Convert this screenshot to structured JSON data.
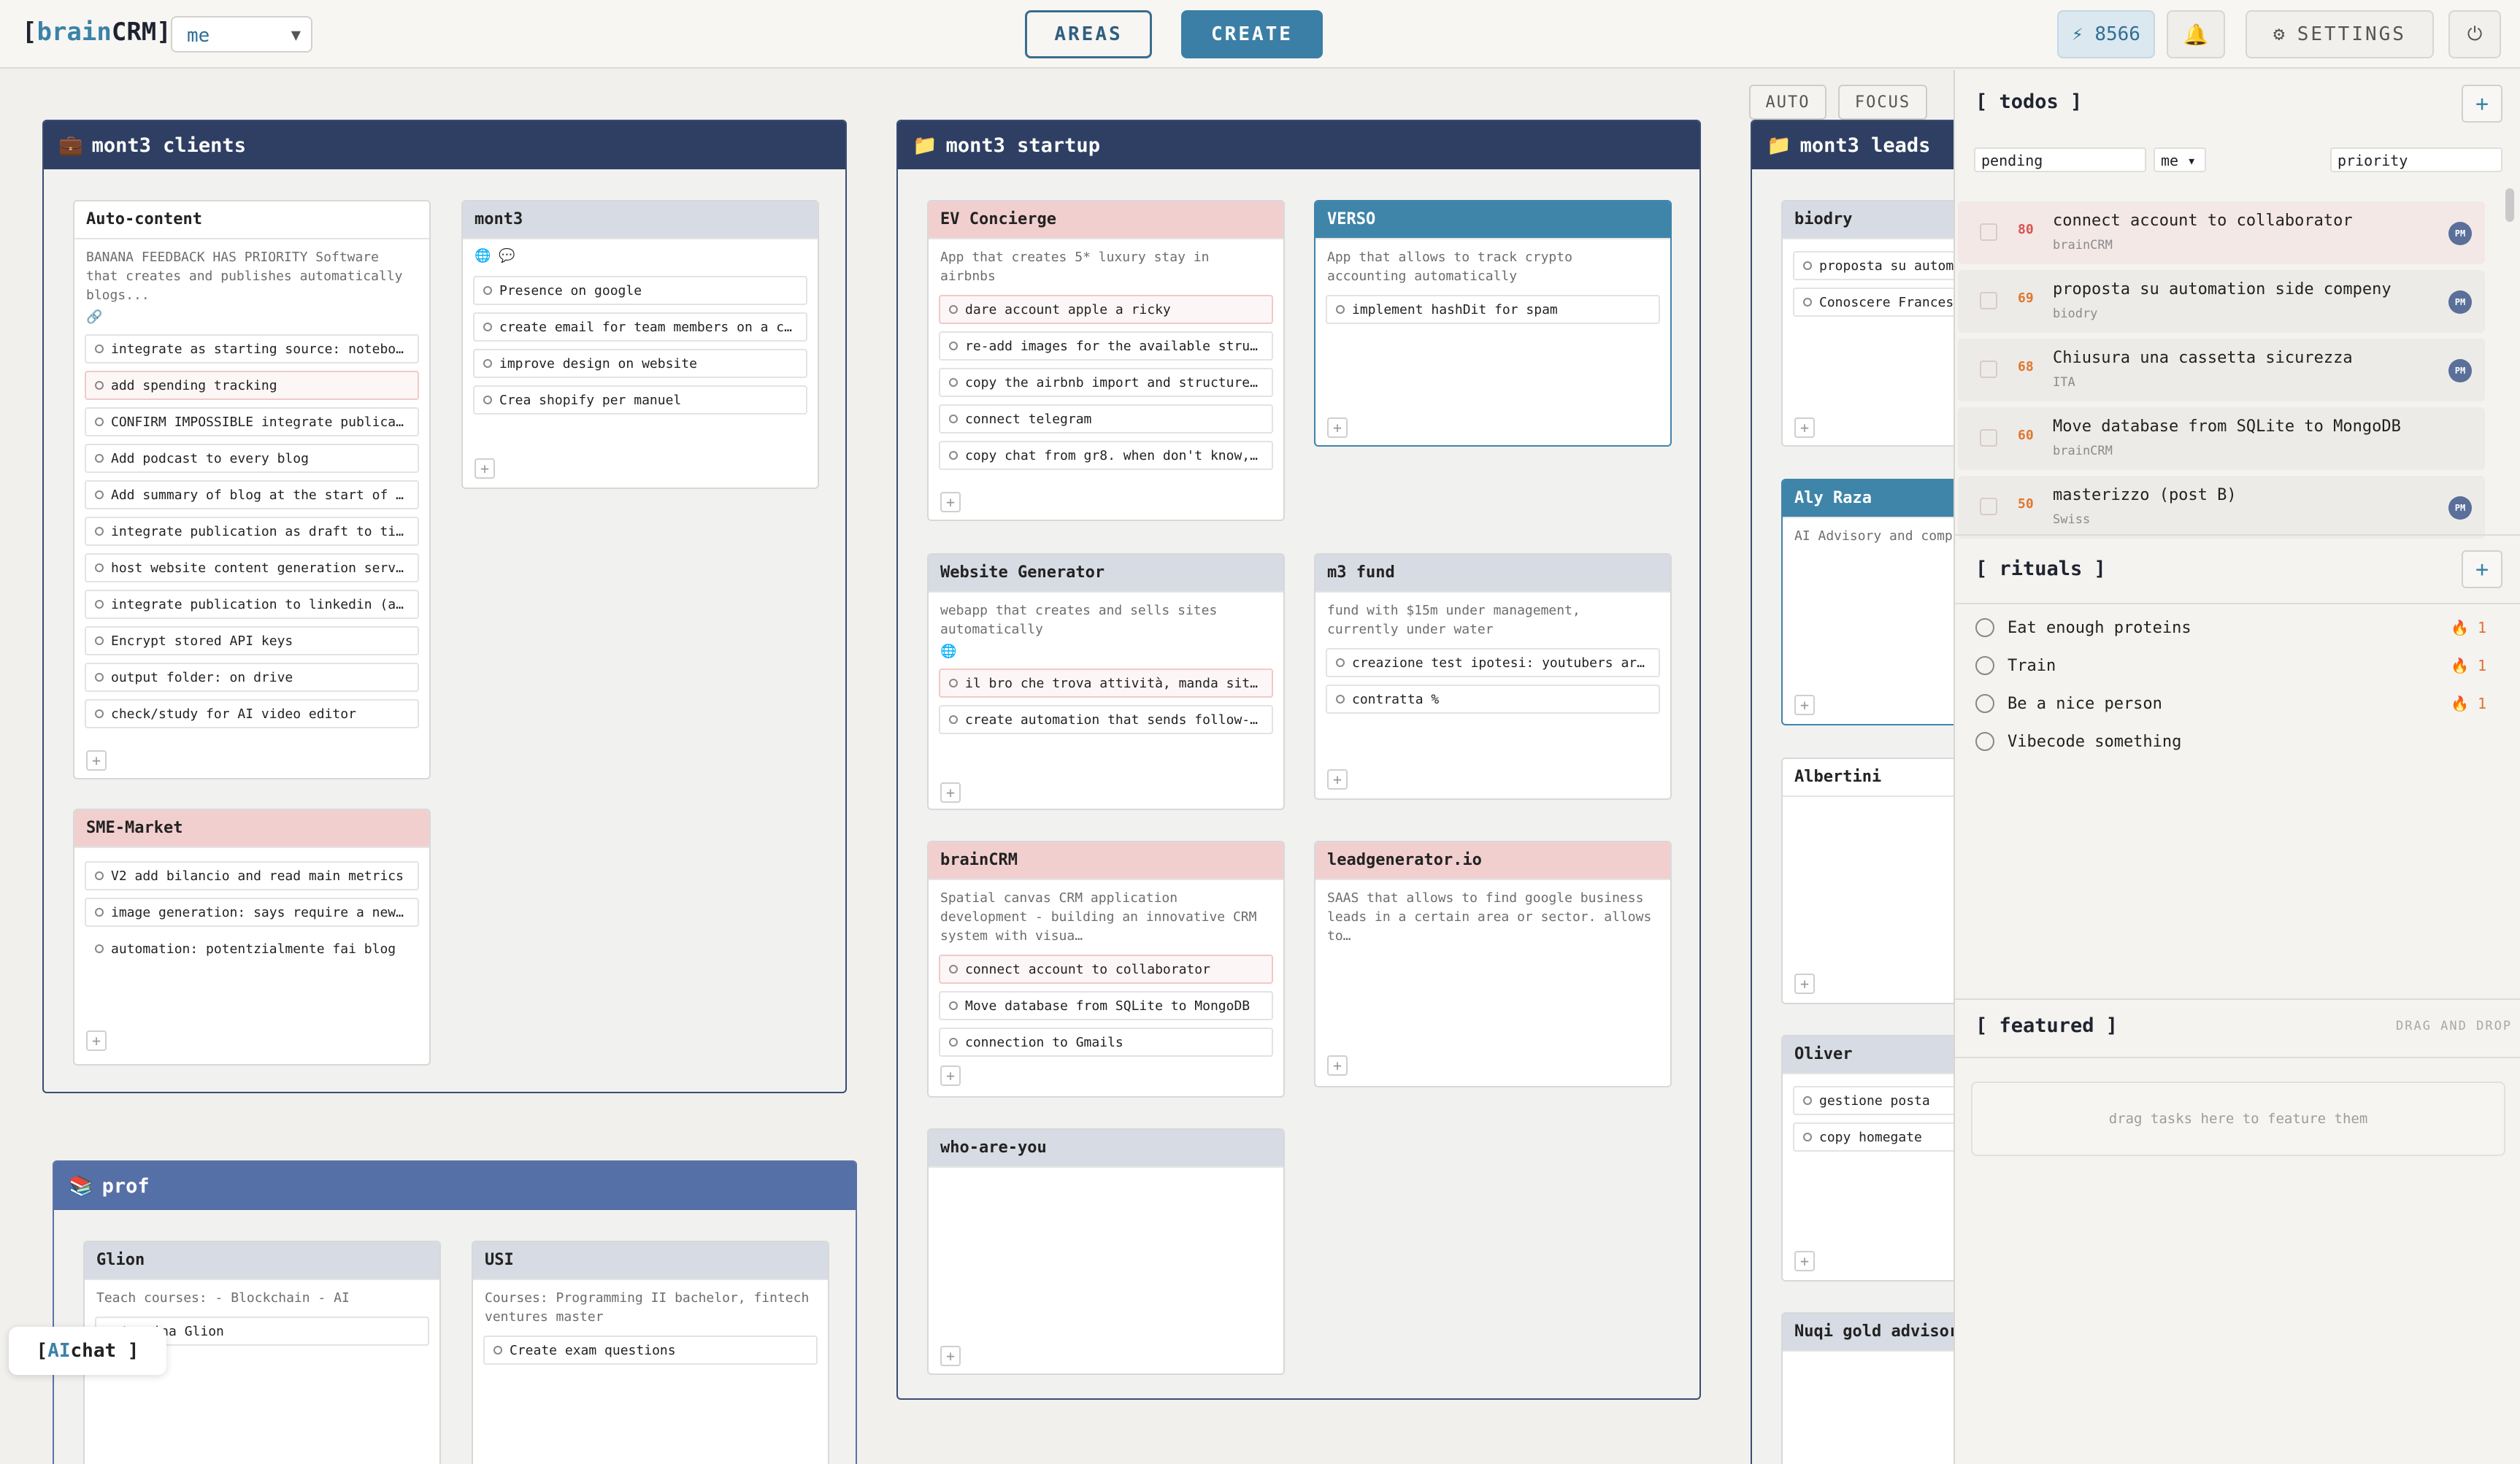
{
  "app": {
    "logo_prefix": "[",
    "logo_brain": "brain",
    "logo_crm": "CRM",
    "logo_suffix": "]",
    "user_select": "me",
    "areas_label": "AREAS",
    "create_label": "CREATE",
    "energy": "⚡ 8566",
    "settings_label": "SETTINGS"
  },
  "canvas": {
    "mode_auto": "AUTO",
    "mode_focus": "FOCUS",
    "areas": {
      "clients": {
        "title": "mont3 clients",
        "cards": {
          "autocontent": {
            "title": "Auto-content",
            "desc": "BANANA FEEDBACK HAS PRIORITY Software that creates and publishes automatically blogs...",
            "tasks": [
              "integrate as starting source: notebo…",
              "add spending tracking",
              "CONFIRM IMPOSSIBLE integrate publica…",
              "Add podcast to every blog",
              "Add summary of blog at the start of …",
              "integrate publication as draft to ti…",
              "host website content generation serv…",
              "integrate publication to linkedin (a…",
              "Encrypt stored API keys",
              "output folder: on drive",
              "check/study for AI video editor"
            ]
          },
          "mont3": {
            "title": "mont3",
            "tasks": [
              "Presence on google",
              "create email for team members on a c…",
              "improve design on website",
              "Crea shopify per manuel"
            ]
          },
          "sme": {
            "title": "SME-Market",
            "tasks": [
              "V2 add bilancio and read main metrics",
              "image generation: says require a new…",
              "automation: potentzialmente fai blog"
            ]
          }
        }
      },
      "startup": {
        "title": "mont3 startup",
        "cards": {
          "ev": {
            "title": "EV Concierge",
            "desc": "App that creates 5* luxury stay in airbnbs",
            "tasks": [
              "dare account apple a ricky",
              "re-add images for the available stru…",
              "copy the airbnb import and structure…",
              "connect telegram",
              "copy chat from gr8. when don't know,…"
            ]
          },
          "verso": {
            "title": "VERSO",
            "desc": "App that allows to track crypto accounting automatically",
            "tasks": [
              "implement hashDit for spam"
            ]
          },
          "website": {
            "title": "Website Generator",
            "desc": "webapp that creates and sells sites automatically",
            "tasks": [
              "il bro che trova attività, manda sit…",
              "create automation that sends follow-…"
            ]
          },
          "m3fund": {
            "title": "m3 fund",
            "desc": "fund with $15m under management, currently under water",
            "tasks": [
              "creazione test ipotesi: youtubers ar…",
              "contratta %"
            ]
          },
          "braincrm": {
            "title": "brainCRM",
            "desc": "Spatial canvas CRM application development - building an innovative CRM system with visua…",
            "tasks": [
              "connect account to collaborator",
              "Move database from SQLite to MongoDB",
              "connection to Gmails"
            ]
          },
          "leadgen": {
            "title": "leadgenerator.io",
            "desc": "SAAS that allows to find google business leads in a certain area or sector. allows to…"
          },
          "whoareyou": {
            "title": "who-are-you"
          }
        }
      },
      "leads": {
        "title": "mont3 leads",
        "cards": {
          "biodry": {
            "title": "biodry",
            "tasks": [
              "proposta su autom",
              "Conoscere Frances"
            ]
          },
          "aly": {
            "title": "Aly Raza",
            "desc": "AI Advisory and compa"
          },
          "albertini": {
            "title": "Albertini"
          },
          "oliver": {
            "title": "Oliver",
            "tasks": [
              "gestione posta",
              "copy homegate"
            ]
          },
          "nuqi": {
            "title": "Nuqi gold advisor"
          }
        }
      },
      "prof": {
        "title": "prof",
        "cards": {
          "glion": {
            "title": "Glion",
            "desc": "Teach courses: - Blockchain - AI",
            "tasks": [
              "termina Glion"
            ]
          },
          "usi": {
            "title": "USI",
            "desc": "Courses: Programming II bachelor, fintech ventures master",
            "tasks": [
              "Create exam questions"
            ]
          }
        }
      }
    },
    "ai_chat": {
      "open": "[ ",
      "ai": "AI",
      "chat": " chat ]"
    }
  },
  "panel": {
    "todos": {
      "title": "[ todos ]",
      "filter_status": "pending",
      "filter_user": "me ▾",
      "filter_sort": "priority",
      "items": [
        {
          "priority": "80",
          "title": "connect account to collaborator",
          "area": "brainCRM",
          "avatar": "PM"
        },
        {
          "priority": "69",
          "title": "proposta su automation side compeny",
          "area": "biodry",
          "avatar": "PM"
        },
        {
          "priority": "68",
          "title": "Chiusura una cassetta sicurezza",
          "area": "ITA",
          "avatar": "PM"
        },
        {
          "priority": "60",
          "title": "Move database from SQLite to MongoDB",
          "area": "brainCRM",
          "avatar": ""
        },
        {
          "priority": "50",
          "title": "masterizzo (post B)",
          "area": "Swiss",
          "avatar": "PM"
        }
      ]
    },
    "rituals": {
      "title": "[ rituals ]",
      "items": [
        {
          "name": "Eat enough proteins",
          "streak": "🔥 1"
        },
        {
          "name": "Train",
          "streak": "🔥 1"
        },
        {
          "name": "Be a nice person",
          "streak": "🔥 1"
        },
        {
          "name": "Vibecode something",
          "streak": ""
        }
      ]
    },
    "featured": {
      "title": "[ featured ]",
      "hint": "DRAG AND DROP",
      "empty": "drag tasks here to feature them"
    }
  },
  "colors": {
    "accent": "#3b7fa6",
    "area_header": "#2e3f63",
    "prof_header": "#5570a6",
    "priority_high": "#d9534f",
    "priority_mid": "#e0772e"
  }
}
